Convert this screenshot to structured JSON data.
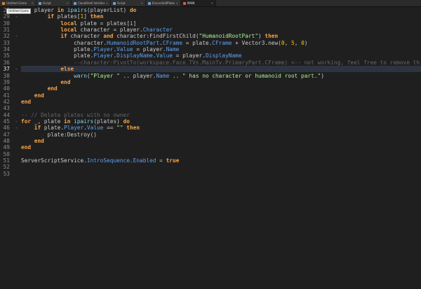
{
  "tabs": [
    {
      "label": "Untitled Game",
      "icon_color": "#d48a2b",
      "active": false
    },
    {
      "label": "Script",
      "icon_color": "#6e9fd6",
      "active": false
    },
    {
      "label": "CloudShell IntroSequence",
      "icon_color": "#6e9fd6",
      "active": false
    },
    {
      "label": "Script",
      "icon_color": "#6e9fd6",
      "active": false
    },
    {
      "label": "EnsureSelfPlates",
      "icon_color": "#6e9fd6",
      "active": false
    },
    {
      "label": "MAIN",
      "icon_color": "#d65a5a",
      "active": true
    }
  ],
  "tab_close_glyph": "×",
  "tooltip": "Untitled Game",
  "editor": {
    "current_line": 37,
    "lines": [
      {
        "n": 28,
        "fold": "⌄",
        "tokens": [
          [
            "pl",
            "    "
          ],
          [
            "pl",
            "player "
          ],
          [
            "kw",
            "in"
          ],
          [
            "pl",
            " "
          ],
          [
            "builtin",
            "ipairs"
          ],
          [
            "pl",
            "(playerList) "
          ],
          [
            "kw",
            "do"
          ]
        ]
      },
      {
        "n": 29,
        "fold": "⌄",
        "tokens": [
          [
            "pl",
            "        "
          ],
          [
            "kw",
            "if"
          ],
          [
            "pl",
            " plates["
          ],
          [
            "num",
            "1"
          ],
          [
            "pl",
            "] "
          ],
          [
            "kw",
            "then"
          ]
        ]
      },
      {
        "n": 30,
        "fold": "",
        "tokens": [
          [
            "pl",
            "            "
          ],
          [
            "kw",
            "local"
          ],
          [
            "pl",
            " plate = plates[i]"
          ]
        ]
      },
      {
        "n": 31,
        "fold": "",
        "tokens": [
          [
            "pl",
            "            "
          ],
          [
            "kw",
            "local"
          ],
          [
            "pl",
            " character = player."
          ],
          [
            "prop",
            "Character"
          ]
        ]
      },
      {
        "n": 32,
        "fold": "⌄",
        "tokens": [
          [
            "pl",
            "            "
          ],
          [
            "kw",
            "if"
          ],
          [
            "pl",
            " character "
          ],
          [
            "kw",
            "and"
          ],
          [
            "pl",
            " character:FindFirstChild("
          ],
          [
            "str",
            "\"HumanoidRootPart\""
          ],
          [
            "pl",
            ") "
          ],
          [
            "kw",
            "then"
          ]
        ]
      },
      {
        "n": 33,
        "fold": "",
        "tokens": [
          [
            "pl",
            "                character."
          ],
          [
            "prop",
            "HumanoidRootPart"
          ],
          [
            "pl",
            "."
          ],
          [
            "prop",
            "CFrame"
          ],
          [
            "pl",
            " = plate."
          ],
          [
            "prop",
            "CFrame"
          ],
          [
            "pl",
            " + Vector3.new("
          ],
          [
            "num",
            "0"
          ],
          [
            "pl",
            ", "
          ],
          [
            "num",
            "5"
          ],
          [
            "pl",
            ", "
          ],
          [
            "num",
            "0"
          ],
          [
            "pl",
            ")"
          ]
        ]
      },
      {
        "n": 34,
        "fold": "",
        "tokens": [
          [
            "pl",
            "                plate."
          ],
          [
            "prop",
            "Player"
          ],
          [
            "pl",
            "."
          ],
          [
            "prop",
            "Value"
          ],
          [
            "pl",
            " = player."
          ],
          [
            "prop",
            "Name"
          ]
        ]
      },
      {
        "n": 35,
        "fold": "",
        "tokens": [
          [
            "pl",
            "                plate."
          ],
          [
            "prop",
            "Player"
          ],
          [
            "pl",
            "."
          ],
          [
            "prop",
            "DisplayName"
          ],
          [
            "pl",
            "."
          ],
          [
            "prop",
            "Value"
          ],
          [
            "pl",
            " = player."
          ],
          [
            "prop",
            "DisplayName"
          ]
        ]
      },
      {
        "n": 36,
        "fold": "",
        "tokens": [
          [
            "pl",
            "                "
          ],
          [
            "cm",
            "--character:PivotTo(workspace.Face.TVs.MainTv.PrimaryPart.CFrame) <-- not working, feel free to remove this lin"
          ]
        ]
      },
      {
        "n": 37,
        "fold": "⌄",
        "tokens": [
          [
            "pl",
            "            "
          ],
          [
            "kw",
            "else"
          ]
        ]
      },
      {
        "n": 38,
        "fold": "",
        "tokens": [
          [
            "pl",
            "                "
          ],
          [
            "builtin",
            "warn"
          ],
          [
            "pl",
            "("
          ],
          [
            "str",
            "\"Player \""
          ],
          [
            "pl",
            " .. player."
          ],
          [
            "prop",
            "Name"
          ],
          [
            "pl",
            " .. "
          ],
          [
            "str",
            "\" has no character or humanoid root part.\""
          ],
          [
            "pl",
            ")"
          ]
        ]
      },
      {
        "n": 39,
        "fold": "",
        "tokens": [
          [
            "pl",
            "            "
          ],
          [
            "kw",
            "end"
          ]
        ]
      },
      {
        "n": 40,
        "fold": "",
        "tokens": [
          [
            "pl",
            "        "
          ],
          [
            "kw",
            "end"
          ]
        ]
      },
      {
        "n": 41,
        "fold": "",
        "tokens": [
          [
            "pl",
            "    "
          ],
          [
            "kw",
            "end"
          ]
        ]
      },
      {
        "n": 42,
        "fold": "",
        "tokens": [
          [
            "kw",
            "end"
          ]
        ]
      },
      {
        "n": 43,
        "fold": "",
        "tokens": []
      },
      {
        "n": 44,
        "fold": "",
        "tokens": [
          [
            "cm",
            "-- // Delete plates with no owner"
          ]
        ]
      },
      {
        "n": 45,
        "fold": "⌄",
        "tokens": [
          [
            "kw",
            "for"
          ],
          [
            "pl",
            " _, plate "
          ],
          [
            "kw",
            "in"
          ],
          [
            "pl",
            " "
          ],
          [
            "builtin",
            "ipairs"
          ],
          [
            "pl",
            "(plates) "
          ],
          [
            "kw",
            "do"
          ]
        ]
      },
      {
        "n": 46,
        "fold": "⌄",
        "tokens": [
          [
            "pl",
            "    "
          ],
          [
            "kw",
            "if"
          ],
          [
            "pl",
            " plate."
          ],
          [
            "prop",
            "Player"
          ],
          [
            "pl",
            "."
          ],
          [
            "prop",
            "Value"
          ],
          [
            "pl",
            " == "
          ],
          [
            "str",
            "\"\""
          ],
          [
            "pl",
            " "
          ],
          [
            "kw",
            "then"
          ]
        ]
      },
      {
        "n": 47,
        "fold": "",
        "tokens": [
          [
            "pl",
            "        plate:Destroy()"
          ]
        ]
      },
      {
        "n": 48,
        "fold": "",
        "tokens": [
          [
            "pl",
            "    "
          ],
          [
            "kw",
            "end"
          ]
        ]
      },
      {
        "n": 49,
        "fold": "",
        "tokens": [
          [
            "kw",
            "end"
          ]
        ]
      },
      {
        "n": 50,
        "fold": "",
        "tokens": []
      },
      {
        "n": 51,
        "fold": "",
        "tokens": [
          [
            "pl",
            "ServerScriptService."
          ],
          [
            "prop",
            "IntroSequence"
          ],
          [
            "pl",
            "."
          ],
          [
            "prop",
            "Enabled"
          ],
          [
            "pl",
            " = "
          ],
          [
            "bool",
            "true"
          ]
        ]
      },
      {
        "n": 52,
        "fold": "",
        "tokens": []
      },
      {
        "n": 53,
        "fold": "",
        "tokens": []
      }
    ]
  }
}
